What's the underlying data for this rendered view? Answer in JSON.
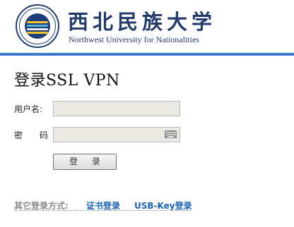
{
  "header": {
    "university_cn": "西北民族大学",
    "university_en": "Northwest University for Nationalities",
    "accent_color": "#3d7cc9"
  },
  "login": {
    "title": "登录SSL VPN",
    "username_label": "用户名:",
    "password_label": "密 码:",
    "username_value": "",
    "password_value": "",
    "submit_label": "登 录"
  },
  "alternatives": {
    "label": "其它登录方式:",
    "links": [
      "证书登录",
      "USB-Key登录"
    ],
    "link_color": "#1a63b8"
  }
}
